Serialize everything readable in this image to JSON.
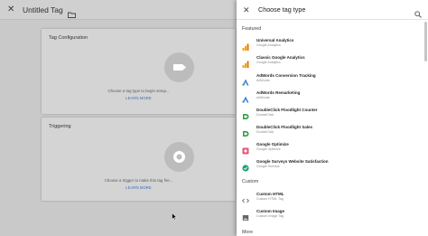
{
  "editor": {
    "title": "Untitled Tag",
    "tag_card": {
      "title": "Tag Configuration",
      "hint": "Choose a tag type to begin setup...",
      "learn_more": "LEARN MORE"
    },
    "trigger_card": {
      "title": "Triggering",
      "hint": "Choose a trigger to make this tag fire...",
      "learn_more": "LEARN MORE"
    }
  },
  "panel": {
    "title": "Choose tag type",
    "sections": {
      "featured": "Featured",
      "custom": "Custom",
      "more": "More"
    },
    "featured_items": [
      {
        "name": "Universal Analytics",
        "sub": "Google Analytics",
        "icon": "analytics-icon"
      },
      {
        "name": "Classic Google Analytics",
        "sub": "Google Analytics",
        "icon": "analytics-icon"
      },
      {
        "name": "AdWords Conversion Tracking",
        "sub": "AdWords",
        "icon": "adwords-icon"
      },
      {
        "name": "AdWords Remarketing",
        "sub": "AdWords",
        "icon": "adwords-icon"
      },
      {
        "name": "DoubleClick Floodlight Counter",
        "sub": "DoubleClick",
        "icon": "doubleclick-icon"
      },
      {
        "name": "DoubleClick Floodlight Sales",
        "sub": "DoubleClick",
        "icon": "doubleclick-icon"
      },
      {
        "name": "Google Optimize",
        "sub": "Google Optimize",
        "icon": "optimize-icon"
      },
      {
        "name": "Google Surveys Website Satisfaction",
        "sub": "Google Surveys",
        "icon": "surveys-icon"
      }
    ],
    "custom_items": [
      {
        "name": "Custom HTML",
        "sub": "Custom HTML Tag",
        "icon": "code-icon"
      },
      {
        "name": "Custom Image",
        "sub": "Custom Image Tag",
        "icon": "image-icon"
      }
    ]
  },
  "colors": {
    "analytics_orange": "#f4a300",
    "adwords_blue": "#3a7de6",
    "doubleclick_red": "#e04b3c",
    "optimize_pink": "#e8537a",
    "surveys_teal": "#1aa37a",
    "link_blue": "#3b6fb5"
  }
}
